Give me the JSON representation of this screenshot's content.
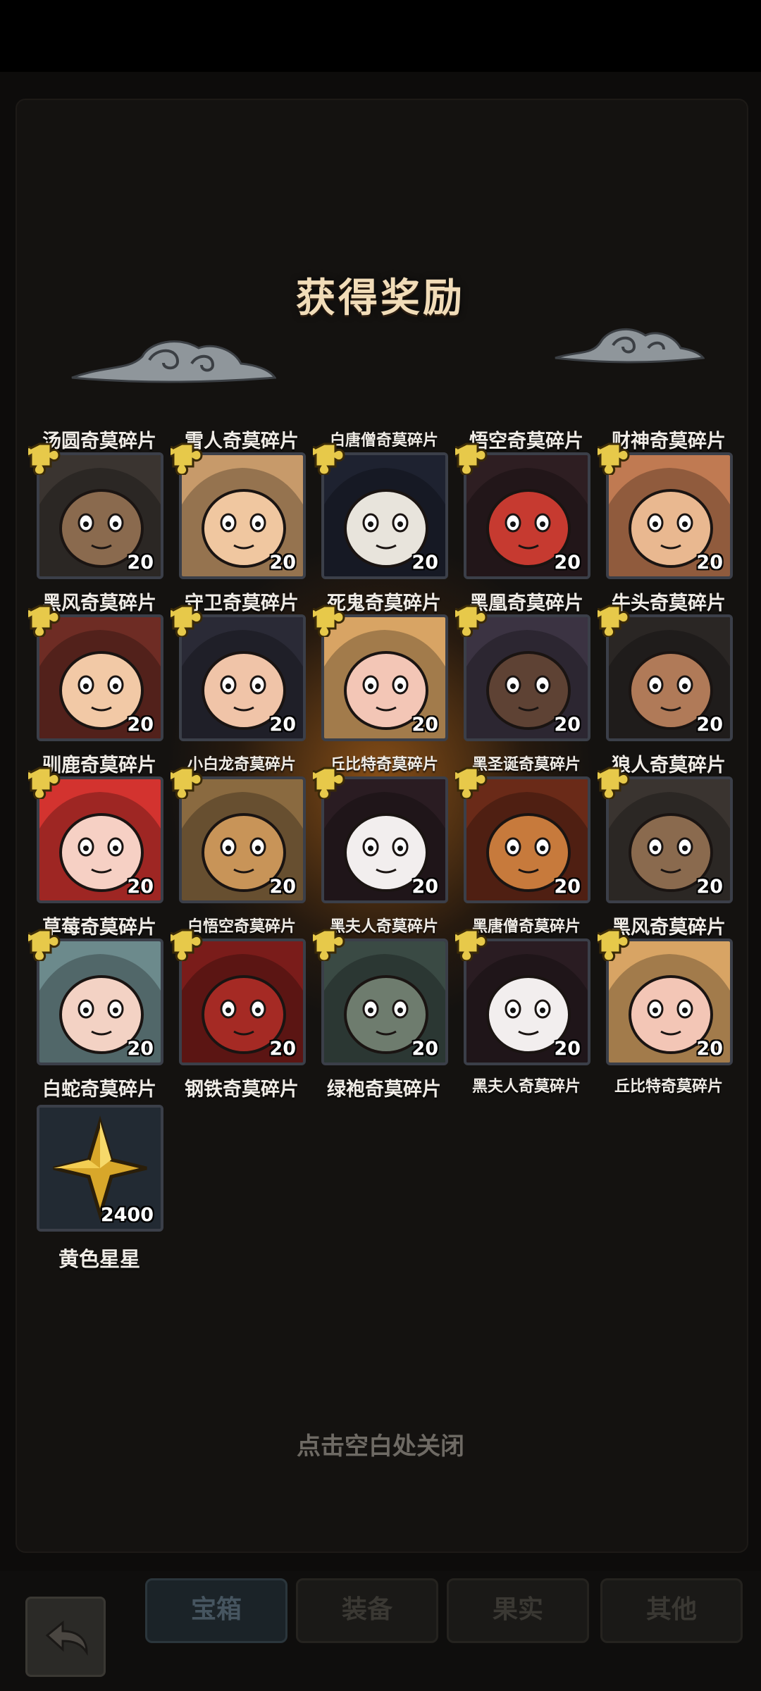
{
  "title": "获得奖励",
  "close_hint": "点击空白处关闭",
  "rows": [
    {
      "items": [
        {
          "name": "汤圆奇莫碎片",
          "count": "20",
          "portrait": "crow-hooded-icon",
          "bg": "#3a3430",
          "skin": "#8a6a4e"
        },
        {
          "name": "雪人奇莫碎片",
          "count": "20",
          "portrait": "shaggy-hair-face-icon",
          "bg": "#c79a6a",
          "skin": "#f0c7a0"
        },
        {
          "name": "白唐僧奇莫碎片",
          "count": "20",
          "portrait": "white-mask-hood-icon",
          "bg": "#1e2230",
          "skin": "#e8e4dc"
        },
        {
          "name": "悟空奇莫碎片",
          "count": "20",
          "portrait": "red-demon-mask-icon",
          "bg": "#2e1e22",
          "skin": "#c63a30"
        },
        {
          "name": "财神奇莫碎片",
          "count": "20",
          "portrait": "tan-bull-face-icon",
          "bg": "#c07a52",
          "skin": "#e9b890"
        }
      ]
    },
    {
      "items": [
        {
          "name": "黑风奇莫碎片",
          "count": "20",
          "portrait": "red-beanie-kid-icon",
          "bg": "#6e2c24",
          "skin": "#f2c9a6"
        },
        {
          "name": "守卫奇莫碎片",
          "count": "20",
          "portrait": "dark-haired-warrior-icon",
          "bg": "#2a2a36",
          "skin": "#f0c4a8"
        },
        {
          "name": "死鬼奇莫碎片",
          "count": "20",
          "portrait": "curly-blonde-blindfold-icon",
          "bg": "#d8a464",
          "skin": "#f3c6b6"
        },
        {
          "name": "黑凰奇莫碎片",
          "count": "20",
          "portrait": "white-hair-dark-skin-icon",
          "bg": "#3b3342",
          "skin": "#5e4234"
        },
        {
          "name": "牛头奇莫碎片",
          "count": "20",
          "portrait": "black-bull-face-icon",
          "bg": "#2a2624",
          "skin": "#b07a58"
        }
      ]
    },
    {
      "items": [
        {
          "name": "驯鹿奇莫碎片",
          "count": "20",
          "portrait": "strawberry-hood-kid-icon",
          "bg": "#d3332f",
          "skin": "#f6d0c4"
        },
        {
          "name": "小白龙奇莫碎片",
          "count": "20",
          "portrait": "golden-monkey-icon",
          "bg": "#8a6a40",
          "skin": "#c89458"
        },
        {
          "name": "丘比特奇莫碎片",
          "count": "20",
          "portrait": "white-skull-horn-icon",
          "bg": "#2a1c22",
          "skin": "#f2eeee"
        },
        {
          "name": "黑圣诞奇莫碎片",
          "count": "20",
          "portrait": "red-golden-hood-icon",
          "bg": "#6a2a18",
          "skin": "#c77a3c"
        },
        {
          "name": "狼人奇莫碎片",
          "count": "20",
          "portrait": "crow-hooded-icon",
          "bg": "#3a3430",
          "skin": "#8a6a4e"
        }
      ]
    },
    {
      "items": [
        {
          "name": "草莓奇莫碎片",
          "count": "20",
          "portrait": "white-long-hair-icon",
          "bg": "#6c8a8c",
          "skin": "#f3d2c4"
        },
        {
          "name": "白悟空奇莫碎片",
          "count": "20",
          "portrait": "red-armor-green-orb-icon",
          "bg": "#7a1c1a",
          "skin": "#a52a24"
        },
        {
          "name": "黑夫人奇莫碎片",
          "count": "20",
          "portrait": "green-hood-icon",
          "bg": "#3a4a44",
          "skin": "#6e7c6e"
        },
        {
          "name": "黑唐僧奇莫碎片",
          "count": "20",
          "portrait": "white-skull-horn-icon",
          "bg": "#2a1c22",
          "skin": "#f2eeee"
        },
        {
          "name": "黑风奇莫碎片",
          "count": "20",
          "portrait": "curly-blonde-blindfold-icon",
          "bg": "#d8a464",
          "skin": "#f3c6b6"
        }
      ]
    }
  ],
  "row5_labels": [
    "白蛇奇莫碎片",
    "钢铁奇莫碎片",
    "绿袍奇莫碎片",
    "黑夫人奇莫碎片",
    "丘比特奇莫碎片"
  ],
  "star_item": {
    "name": "黄色星星",
    "count": "2400",
    "icon": "yellow-star-icon"
  },
  "tabs": [
    {
      "label": "宝箱",
      "active": true
    },
    {
      "label": "装备",
      "active": false
    },
    {
      "label": "果实",
      "active": false
    },
    {
      "label": "其他",
      "active": false
    }
  ],
  "back_icon": "back-arrow-icon"
}
